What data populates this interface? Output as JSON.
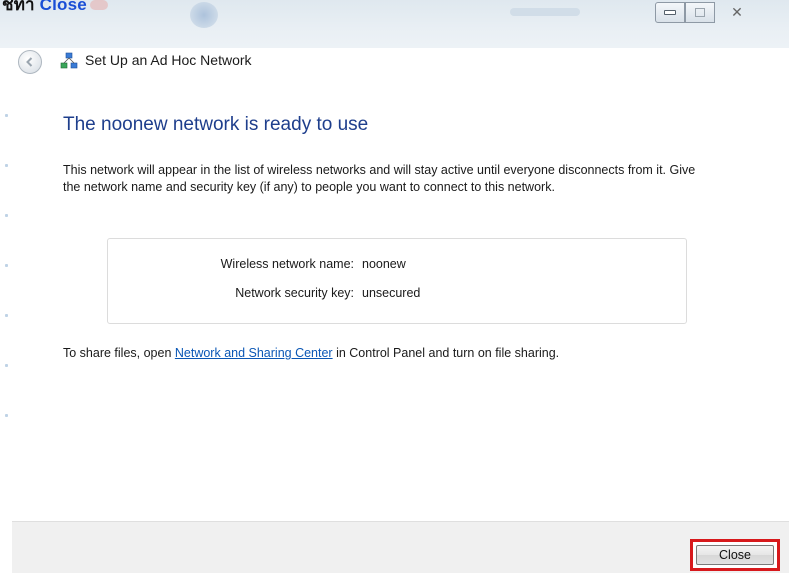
{
  "page_caption": {
    "prefix": "ชิทำ",
    "link": "Close"
  },
  "window": {
    "title": "Set Up an Ad Hoc Network",
    "minimize_icon": "minimize-icon",
    "maximize_icon": "maximize-icon",
    "close_glyph": "✕"
  },
  "content": {
    "heading": "The noonew network is ready to use",
    "description": "This network will appear in the list of wireless networks and will stay active until everyone disconnects from it. Give the network name and security key (if any) to people you want to connect to this network.",
    "info": [
      {
        "label": "Wireless network name:",
        "value": "noonew"
      },
      {
        "label": "Network security key:",
        "value": "unsecured"
      }
    ],
    "share": {
      "before": "To share files, open ",
      "link": "Network and Sharing Center",
      "after": " in Control Panel and turn on file sharing."
    }
  },
  "footer": {
    "close_label": "Close"
  },
  "colors": {
    "heading": "#1e3e8c",
    "link": "#0b57b5",
    "highlight": "#d7191c"
  }
}
